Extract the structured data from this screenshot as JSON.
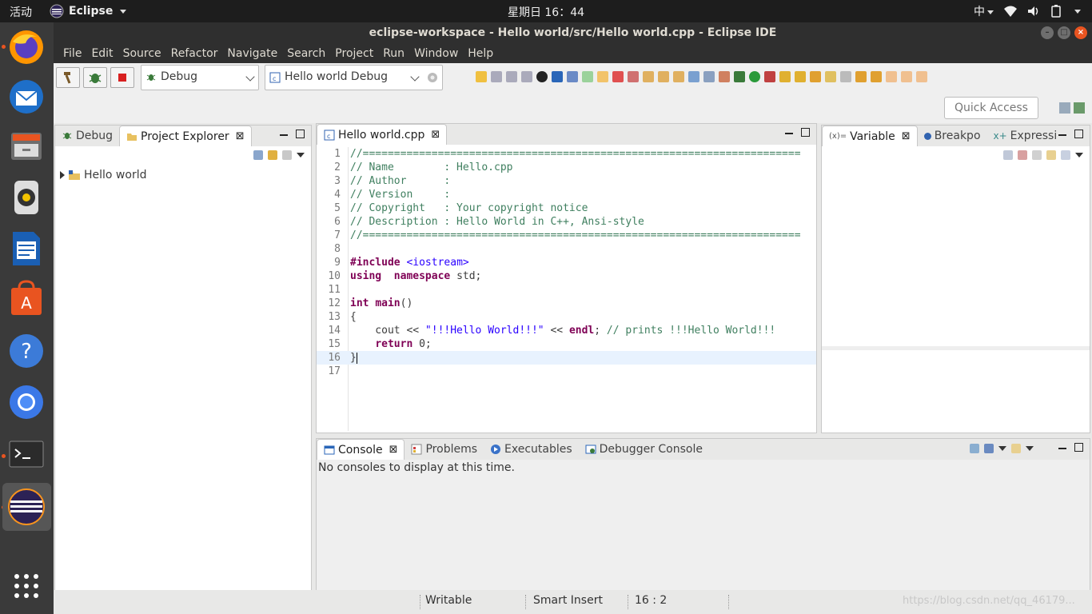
{
  "topbar": {
    "activities": "活动",
    "app_name": "Eclipse",
    "clock": "星期日 16：44",
    "input_method": "中"
  },
  "dock": {
    "items": [
      "firefox-icon",
      "thunderbird-icon",
      "files-icon",
      "rhythmbox-icon",
      "libreoffice-writer-icon",
      "software-center-icon",
      "help-icon",
      "chromium-icon",
      "terminal-icon",
      "eclipse-icon",
      "show-apps-icon"
    ]
  },
  "window": {
    "title": "eclipse-workspace - Hello world/src/Hello world.cpp - Eclipse IDE"
  },
  "menu": [
    "File",
    "Edit",
    "Source",
    "Refactor",
    "Navigate",
    "Search",
    "Project",
    "Run",
    "Window",
    "Help"
  ],
  "toolbar": {
    "launch_mode": "Debug",
    "launch_config": "Hello world Debug",
    "quick_access": "Quick Access"
  },
  "left_panel": {
    "tabs": [
      "Debug",
      "Project Explorer"
    ],
    "tree": [
      "Hello world"
    ]
  },
  "editor": {
    "tab": "Hello world.cpp",
    "lines": [
      {
        "n": "1",
        "segs": [
          [
            "cm",
            "//======================================================================"
          ]
        ]
      },
      {
        "n": "2",
        "segs": [
          [
            "cm",
            "// Name        : Hello.cpp"
          ]
        ]
      },
      {
        "n": "3",
        "segs": [
          [
            "cm",
            "// Author      :"
          ]
        ]
      },
      {
        "n": "4",
        "segs": [
          [
            "cm",
            "// Version     :"
          ]
        ]
      },
      {
        "n": "5",
        "segs": [
          [
            "cm",
            "// Copyright   : Your copyright notice"
          ]
        ]
      },
      {
        "n": "6",
        "segs": [
          [
            "cm",
            "// Description : Hello World in C++, Ansi-style"
          ]
        ]
      },
      {
        "n": "7",
        "segs": [
          [
            "cm",
            "//======================================================================"
          ]
        ]
      },
      {
        "n": "8",
        "segs": []
      },
      {
        "n": "9",
        "segs": [
          [
            "pp",
            "#include "
          ],
          [
            "inc",
            "<iostream>"
          ]
        ]
      },
      {
        "n": "10",
        "segs": [
          [
            "kw",
            "using"
          ],
          [
            "",
            "  "
          ],
          [
            "kw",
            "namespace"
          ],
          [
            "",
            " std;"
          ]
        ]
      },
      {
        "n": "11",
        "segs": []
      },
      {
        "n": "12",
        "segs": [
          [
            "kw",
            "int"
          ],
          [
            "",
            " "
          ],
          [
            "kw",
            "main"
          ],
          [
            "",
            "()"
          ]
        ]
      },
      {
        "n": "13",
        "segs": [
          [
            "",
            "{"
          ]
        ]
      },
      {
        "n": "14",
        "segs": [
          [
            "",
            "    cout << "
          ],
          [
            "st",
            "\"!!!Hello World!!!\""
          ],
          [
            "",
            " << "
          ],
          [
            "kw",
            "endl"
          ],
          [
            "",
            "; "
          ],
          [
            "cm",
            "// prints !!!Hello World!!!"
          ]
        ]
      },
      {
        "n": "15",
        "segs": [
          [
            "",
            "    "
          ],
          [
            "kw",
            "return"
          ],
          [
            "",
            " 0;"
          ]
        ]
      },
      {
        "n": "16",
        "segs": [
          [
            "",
            "}"
          ]
        ]
      },
      {
        "n": "17",
        "segs": []
      }
    ]
  },
  "right_panel": {
    "tabs": [
      "Variable",
      "Breakpo",
      "Expressi"
    ]
  },
  "console_panel": {
    "tabs": [
      "Console",
      "Problems",
      "Executables",
      "Debugger Console"
    ],
    "message": "No consoles to display at this time."
  },
  "status": {
    "writable": "Writable",
    "insert_mode": "Smart Insert",
    "position": "16 : 2"
  },
  "watermark": "https://blog.csdn.net/qq_46179..."
}
